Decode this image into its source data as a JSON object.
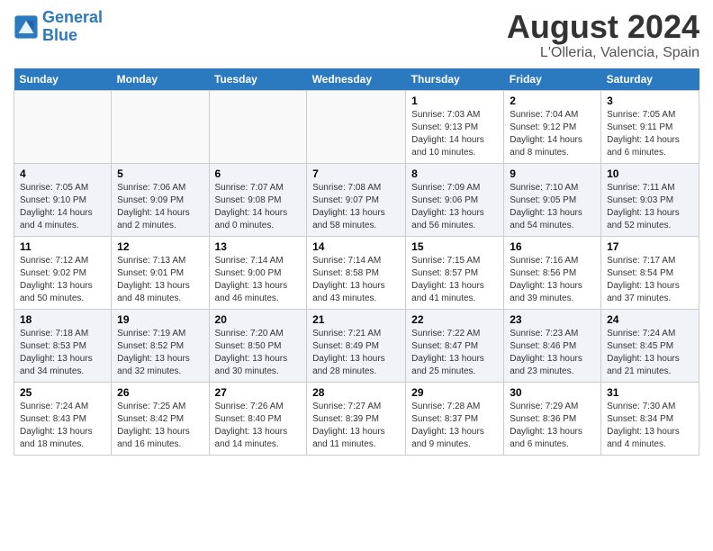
{
  "header": {
    "logo_line1": "General",
    "logo_line2": "Blue",
    "title": "August 2024",
    "subtitle": "L'Olleria, Valencia, Spain"
  },
  "weekdays": [
    "Sunday",
    "Monday",
    "Tuesday",
    "Wednesday",
    "Thursday",
    "Friday",
    "Saturday"
  ],
  "weeks": [
    [
      {
        "day": "",
        "info": ""
      },
      {
        "day": "",
        "info": ""
      },
      {
        "day": "",
        "info": ""
      },
      {
        "day": "",
        "info": ""
      },
      {
        "day": "1",
        "info": "Sunrise: 7:03 AM\nSunset: 9:13 PM\nDaylight: 14 hours\nand 10 minutes."
      },
      {
        "day": "2",
        "info": "Sunrise: 7:04 AM\nSunset: 9:12 PM\nDaylight: 14 hours\nand 8 minutes."
      },
      {
        "day": "3",
        "info": "Sunrise: 7:05 AM\nSunset: 9:11 PM\nDaylight: 14 hours\nand 6 minutes."
      }
    ],
    [
      {
        "day": "4",
        "info": "Sunrise: 7:05 AM\nSunset: 9:10 PM\nDaylight: 14 hours\nand 4 minutes."
      },
      {
        "day": "5",
        "info": "Sunrise: 7:06 AM\nSunset: 9:09 PM\nDaylight: 14 hours\nand 2 minutes."
      },
      {
        "day": "6",
        "info": "Sunrise: 7:07 AM\nSunset: 9:08 PM\nDaylight: 14 hours\nand 0 minutes."
      },
      {
        "day": "7",
        "info": "Sunrise: 7:08 AM\nSunset: 9:07 PM\nDaylight: 13 hours\nand 58 minutes."
      },
      {
        "day": "8",
        "info": "Sunrise: 7:09 AM\nSunset: 9:06 PM\nDaylight: 13 hours\nand 56 minutes."
      },
      {
        "day": "9",
        "info": "Sunrise: 7:10 AM\nSunset: 9:05 PM\nDaylight: 13 hours\nand 54 minutes."
      },
      {
        "day": "10",
        "info": "Sunrise: 7:11 AM\nSunset: 9:03 PM\nDaylight: 13 hours\nand 52 minutes."
      }
    ],
    [
      {
        "day": "11",
        "info": "Sunrise: 7:12 AM\nSunset: 9:02 PM\nDaylight: 13 hours\nand 50 minutes."
      },
      {
        "day": "12",
        "info": "Sunrise: 7:13 AM\nSunset: 9:01 PM\nDaylight: 13 hours\nand 48 minutes."
      },
      {
        "day": "13",
        "info": "Sunrise: 7:14 AM\nSunset: 9:00 PM\nDaylight: 13 hours\nand 46 minutes."
      },
      {
        "day": "14",
        "info": "Sunrise: 7:14 AM\nSunset: 8:58 PM\nDaylight: 13 hours\nand 43 minutes."
      },
      {
        "day": "15",
        "info": "Sunrise: 7:15 AM\nSunset: 8:57 PM\nDaylight: 13 hours\nand 41 minutes."
      },
      {
        "day": "16",
        "info": "Sunrise: 7:16 AM\nSunset: 8:56 PM\nDaylight: 13 hours\nand 39 minutes."
      },
      {
        "day": "17",
        "info": "Sunrise: 7:17 AM\nSunset: 8:54 PM\nDaylight: 13 hours\nand 37 minutes."
      }
    ],
    [
      {
        "day": "18",
        "info": "Sunrise: 7:18 AM\nSunset: 8:53 PM\nDaylight: 13 hours\nand 34 minutes."
      },
      {
        "day": "19",
        "info": "Sunrise: 7:19 AM\nSunset: 8:52 PM\nDaylight: 13 hours\nand 32 minutes."
      },
      {
        "day": "20",
        "info": "Sunrise: 7:20 AM\nSunset: 8:50 PM\nDaylight: 13 hours\nand 30 minutes."
      },
      {
        "day": "21",
        "info": "Sunrise: 7:21 AM\nSunset: 8:49 PM\nDaylight: 13 hours\nand 28 minutes."
      },
      {
        "day": "22",
        "info": "Sunrise: 7:22 AM\nSunset: 8:47 PM\nDaylight: 13 hours\nand 25 minutes."
      },
      {
        "day": "23",
        "info": "Sunrise: 7:23 AM\nSunset: 8:46 PM\nDaylight: 13 hours\nand 23 minutes."
      },
      {
        "day": "24",
        "info": "Sunrise: 7:24 AM\nSunset: 8:45 PM\nDaylight: 13 hours\nand 21 minutes."
      }
    ],
    [
      {
        "day": "25",
        "info": "Sunrise: 7:24 AM\nSunset: 8:43 PM\nDaylight: 13 hours\nand 18 minutes."
      },
      {
        "day": "26",
        "info": "Sunrise: 7:25 AM\nSunset: 8:42 PM\nDaylight: 13 hours\nand 16 minutes."
      },
      {
        "day": "27",
        "info": "Sunrise: 7:26 AM\nSunset: 8:40 PM\nDaylight: 13 hours\nand 14 minutes."
      },
      {
        "day": "28",
        "info": "Sunrise: 7:27 AM\nSunset: 8:39 PM\nDaylight: 13 hours\nand 11 minutes."
      },
      {
        "day": "29",
        "info": "Sunrise: 7:28 AM\nSunset: 8:37 PM\nDaylight: 13 hours\nand 9 minutes."
      },
      {
        "day": "30",
        "info": "Sunrise: 7:29 AM\nSunset: 8:36 PM\nDaylight: 13 hours\nand 6 minutes."
      },
      {
        "day": "31",
        "info": "Sunrise: 7:30 AM\nSunset: 8:34 PM\nDaylight: 13 hours\nand 4 minutes."
      }
    ]
  ]
}
